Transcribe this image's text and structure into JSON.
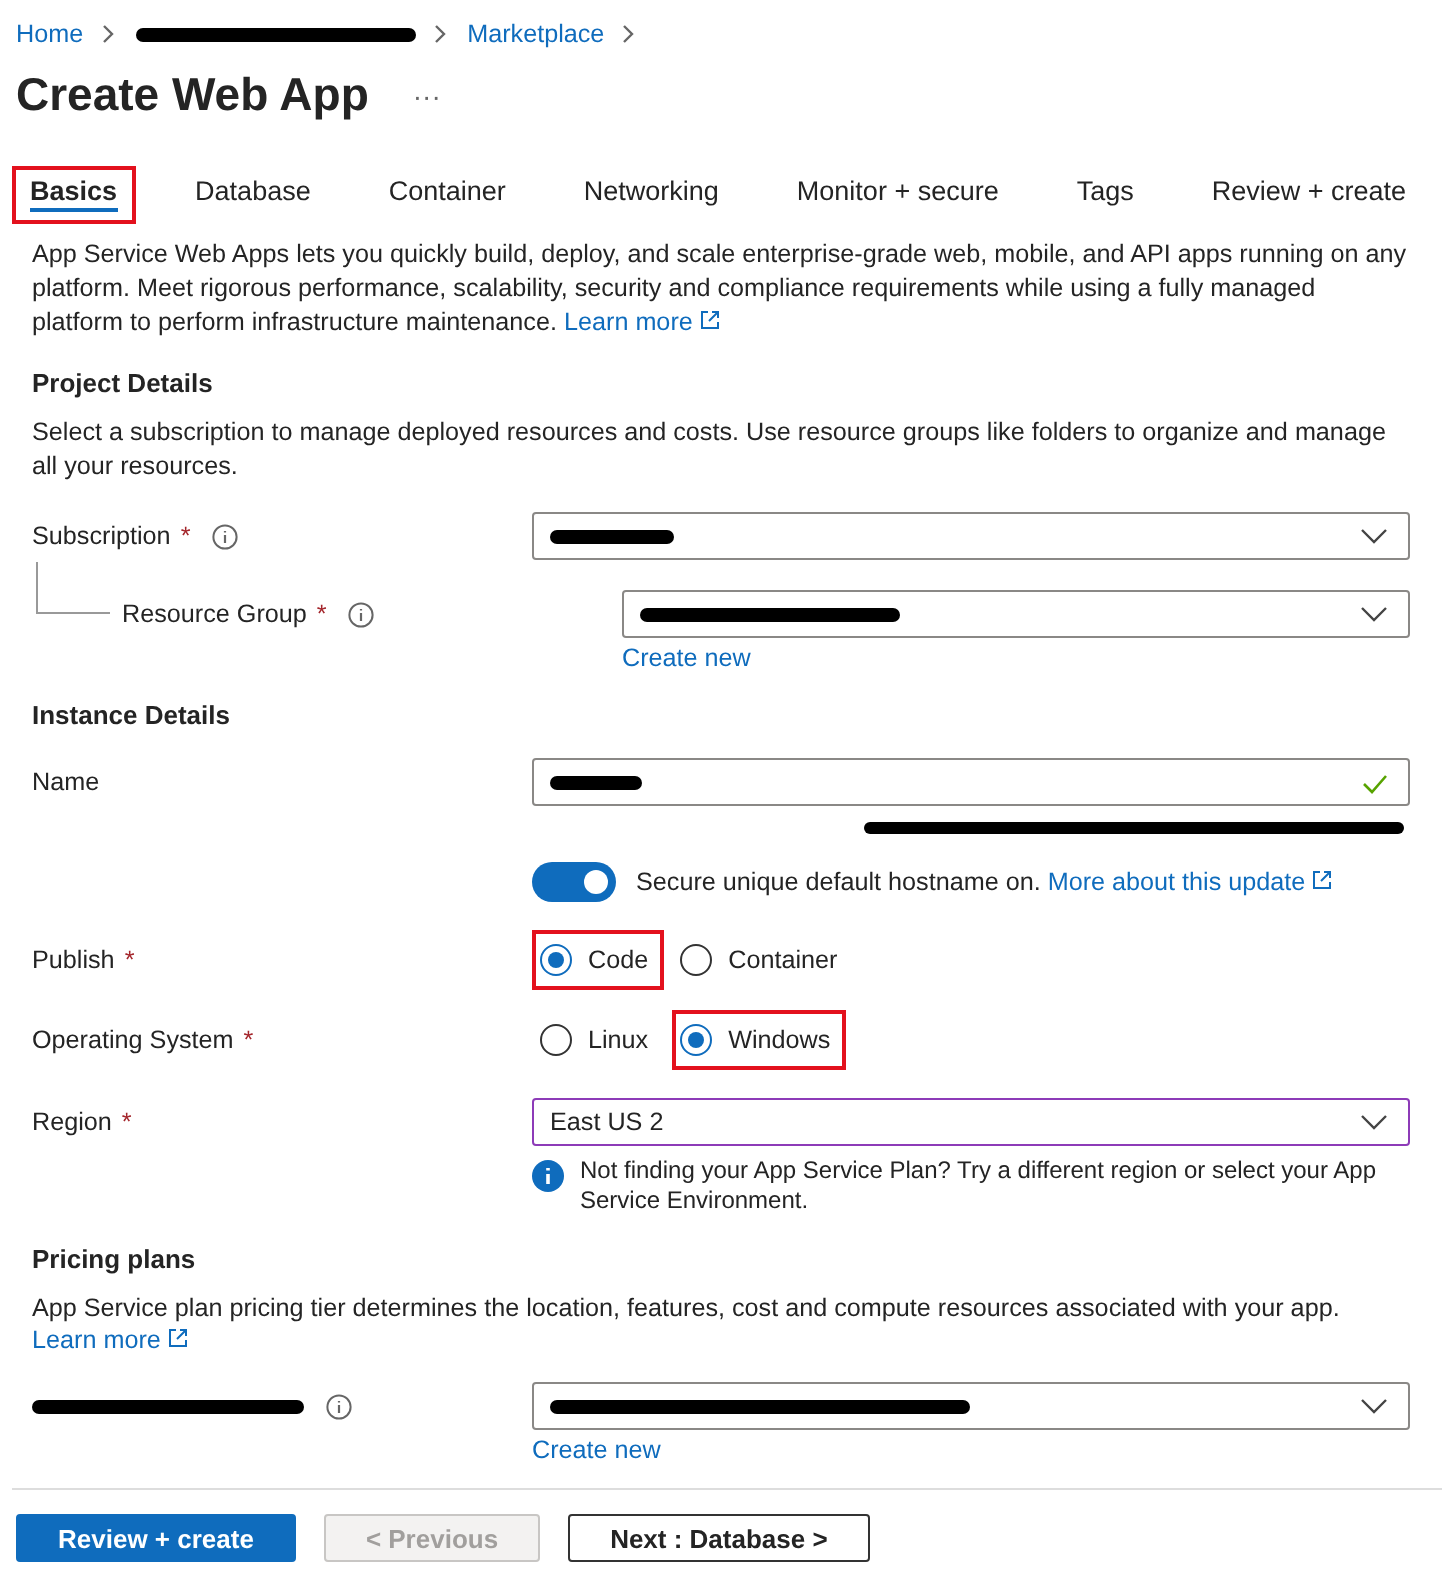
{
  "breadcrumb": [
    {
      "label": "Home",
      "redacted": false
    },
    {
      "redacted": true
    },
    {
      "label": "Marketplace",
      "redacted": false
    }
  ],
  "title": "Create Web App",
  "more": "···",
  "tabs": [
    {
      "label": "Basics",
      "selected": true,
      "highlighted": true
    },
    {
      "label": "Database",
      "selected": false,
      "highlighted": false
    },
    {
      "label": "Container",
      "selected": false,
      "highlighted": false
    },
    {
      "label": "Networking",
      "selected": false,
      "highlighted": false
    },
    {
      "label": "Monitor + secure",
      "selected": false,
      "highlighted": false
    },
    {
      "label": "Tags",
      "selected": false,
      "highlighted": false
    },
    {
      "label": "Review + create",
      "selected": false,
      "highlighted": false
    }
  ],
  "intro": {
    "text": "App Service Web Apps lets you quickly build, deploy, and scale enterprise-grade web, mobile, and API apps running on any platform. Meet rigorous performance, scalability, security and compliance requirements while using a fully managed platform to perform infrastructure maintenance.",
    "link": "Learn more"
  },
  "project": {
    "heading": "Project Details",
    "description": "Select a subscription to manage deployed resources and costs. Use resource groups like folders to organize and manage all your resources.",
    "subscription": {
      "label": "Subscription",
      "required": "*",
      "info": true,
      "redacted": true
    },
    "resource_group": {
      "label": "Resource Group",
      "required": "*",
      "info": true,
      "redacted": true,
      "create_link": "Create new"
    }
  },
  "instance": {
    "heading": "Instance Details",
    "name": {
      "label": "Name",
      "redacted": true,
      "valid": true,
      "hostname_redacted": true
    },
    "hostname_toggle": {
      "on": true,
      "text": "Secure unique default hostname on.",
      "link": "More about this update"
    },
    "publish": {
      "label": "Publish",
      "required": "*",
      "options": [
        {
          "label": "Code",
          "selected": true,
          "highlighted": true
        },
        {
          "label": "Container",
          "selected": false,
          "highlighted": false
        }
      ]
    },
    "os": {
      "label": "Operating System",
      "required": "*",
      "options": [
        {
          "label": "Linux",
          "selected": false,
          "highlighted": false
        },
        {
          "label": "Windows",
          "selected": true,
          "highlighted": true
        }
      ]
    },
    "region": {
      "label": "Region",
      "required": "*",
      "value": "East US 2",
      "note": "Not finding your App Service Plan? Try a different region or select your App Service Environment."
    }
  },
  "pricing": {
    "heading": "Pricing plans",
    "description": "App Service plan pricing tier determines the location, features, cost and compute resources associated with your app.",
    "link": "Learn more",
    "plan": {
      "label_redacted": true,
      "info": true,
      "redacted": true,
      "create_link": "Create new"
    }
  },
  "footer": [
    {
      "label": "Review + create",
      "kind": "primary",
      "disabled": false
    },
    {
      "label": "< Previous",
      "kind": "secondary",
      "disabled": true
    },
    {
      "label": "Next : Database >",
      "kind": "secondary",
      "disabled": false
    }
  ]
}
